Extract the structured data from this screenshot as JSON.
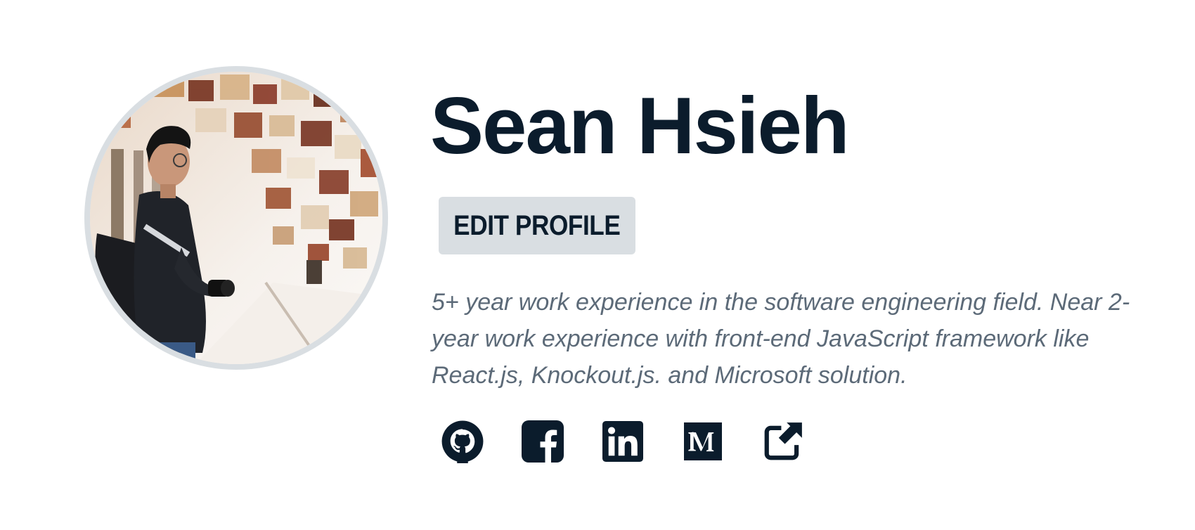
{
  "profile": {
    "name": "Sean Hsieh",
    "edit_label": "EDIT PROFILE",
    "bio": "5+ year work experience in the software engineering field. Near 2-year work experience with front-end JavaScript framework like React.js, Knockout.js. and Microsoft solution.",
    "avatar_icon": "profile-photo"
  },
  "socials": [
    {
      "icon": "github-icon",
      "label": "GitHub"
    },
    {
      "icon": "facebook-icon",
      "label": "Facebook"
    },
    {
      "icon": "linkedin-icon",
      "label": "LinkedIn"
    },
    {
      "icon": "medium-icon",
      "label": "Medium"
    },
    {
      "icon": "external-link-icon",
      "label": "External link"
    }
  ],
  "colors": {
    "text": "#0b1c2c",
    "muted": "#5c6a78",
    "button_bg": "#d9dee2",
    "avatar_border": "#d9dee2"
  }
}
